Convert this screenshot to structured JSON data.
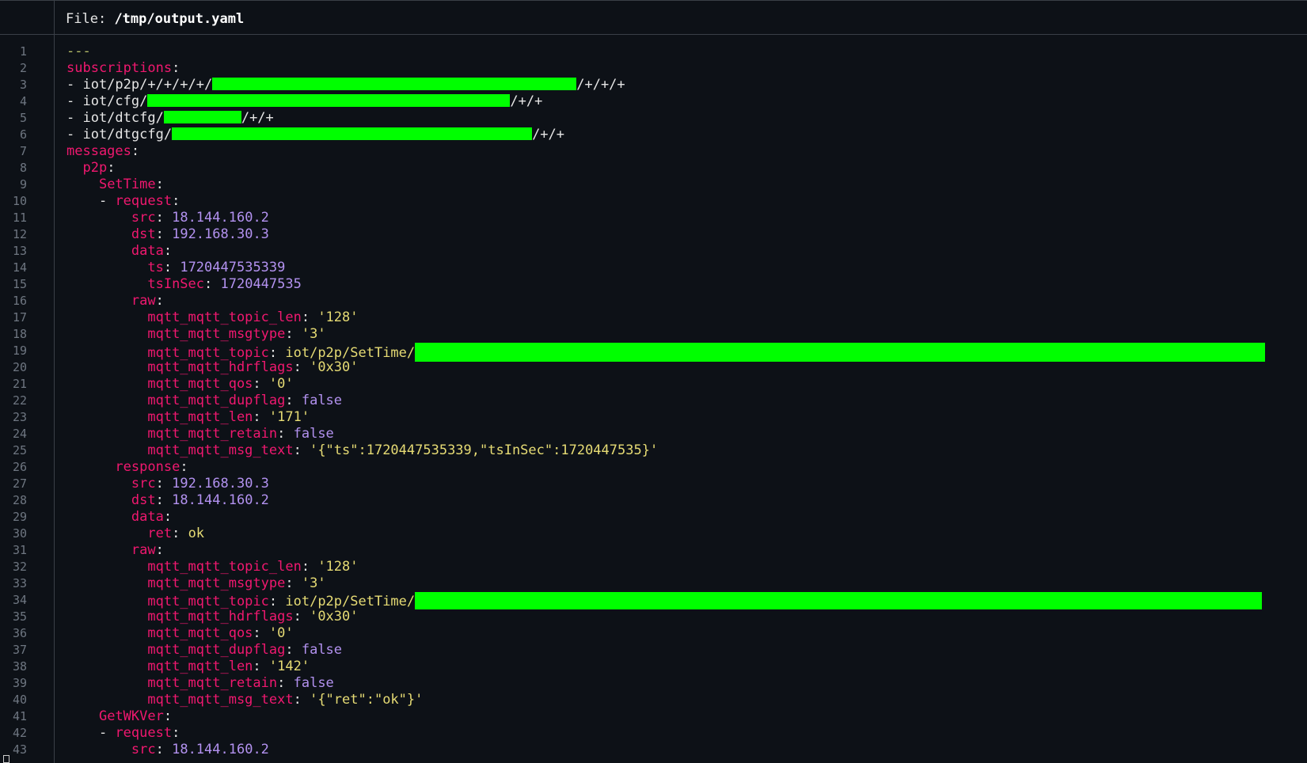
{
  "header": {
    "label": "File:",
    "path": "/tmp/output.yaml"
  },
  "line_numbers": [
    "1",
    "2",
    "3",
    "4",
    "5",
    "6",
    "7",
    "8",
    "9",
    "10",
    "11",
    "12",
    "13",
    "14",
    "15",
    "16",
    "17",
    "18",
    "19",
    "20",
    "21",
    "22",
    "23",
    "24",
    "25",
    "26",
    "27",
    "28",
    "29",
    "30",
    "31",
    "32",
    "33",
    "34",
    "35",
    "36",
    "37",
    "38",
    "39",
    "40",
    "41",
    "42",
    "43"
  ],
  "lines": {
    "l1": "---",
    "l2_key": "subscriptions",
    "l3_a": "- iot/p2p/+/+/+/+/",
    "l3_b": "/+/+/+",
    "l4_a": "- iot/cfg/",
    "l4_b": "/+/+",
    "l5_a": "- iot/dtcfg/",
    "l5_b": "/+/+",
    "l6_a": "- iot/dtgcfg/",
    "l6_b": "/+/+",
    "l7_key": "messages",
    "l8_key": "p2p",
    "l9_key": "SetTime",
    "l10_key": "request",
    "l11_key": "src",
    "l11_val": "18.144.160.2",
    "l12_key": "dst",
    "l12_val": "192.168.30.3",
    "l13_key": "data",
    "l14_key": "ts",
    "l14_val": "1720447535339",
    "l15_key": "tsInSec",
    "l15_val": "1720447535",
    "l16_key": "raw",
    "l17_key": "mqtt_mqtt_topic_len",
    "l17_val": "'128'",
    "l18_key": "mqtt_mqtt_msgtype",
    "l18_val": "'3'",
    "l19_key": "mqtt_mqtt_topic",
    "l19_val": "iot/p2p/SetTime/",
    "l20_key": "mqtt_mqtt_hdrflags",
    "l20_val": "'0x30'",
    "l21_key": "mqtt_mqtt_qos",
    "l21_val": "'0'",
    "l22_key": "mqtt_mqtt_dupflag",
    "l22_val": "false",
    "l23_key": "mqtt_mqtt_len",
    "l23_val": "'171'",
    "l24_key": "mqtt_mqtt_retain",
    "l24_val": "false",
    "l25_key": "mqtt_mqtt_msg_text",
    "l25_val": "'{\"ts\":1720447535339,\"tsInSec\":1720447535}'",
    "l26_key": "response",
    "l27_key": "src",
    "l27_val": "192.168.30.3",
    "l28_key": "dst",
    "l28_val": "18.144.160.2",
    "l29_key": "data",
    "l30_key": "ret",
    "l30_val": "ok",
    "l31_key": "raw",
    "l32_key": "mqtt_mqtt_topic_len",
    "l32_val": "'128'",
    "l33_key": "mqtt_mqtt_msgtype",
    "l33_val": "'3'",
    "l34_key": "mqtt_mqtt_topic",
    "l34_val": "iot/p2p/SetTime/",
    "l35_key": "mqtt_mqtt_hdrflags",
    "l35_val": "'0x30'",
    "l36_key": "mqtt_mqtt_qos",
    "l36_val": "'0'",
    "l37_key": "mqtt_mqtt_dupflag",
    "l37_val": "false",
    "l38_key": "mqtt_mqtt_len",
    "l38_val": "'142'",
    "l39_key": "mqtt_mqtt_retain",
    "l39_val": "false",
    "l40_key": "mqtt_mqtt_msg_text",
    "l40_val": "'{\"ret\":\"ok\"}'",
    "l41_key": "GetWKVer",
    "l42_key": "request",
    "l43_key": "src",
    "l43_val": "18.144.160.2"
  },
  "colors": {
    "background": "#0d1117",
    "key": "#f0186f",
    "number": "#b392f0",
    "string": "#e6db74",
    "redaction": "#00ff00"
  }
}
